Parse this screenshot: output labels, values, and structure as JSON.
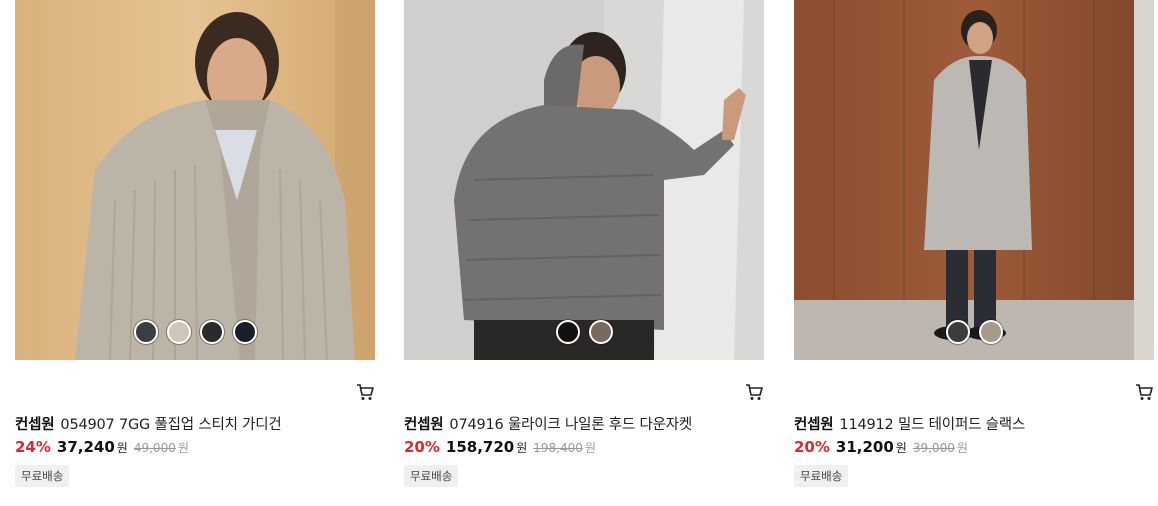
{
  "products": [
    {
      "brand": "컨셉원",
      "name": "054907 7GG 풀집업 스티치 가디건",
      "discount": "24%",
      "price": "37,240",
      "currency": "원",
      "original_price": "49,000",
      "badge": "무료배송",
      "swatch_colors": [
        "#3b3f44",
        "#cfc6b5",
        "#2b2b2b",
        "#1a1e2a"
      ]
    },
    {
      "brand": "컨셉원",
      "name": "074916 울라이크 나일론 후드 다운자켓",
      "discount": "20%",
      "price": "158,720",
      "currency": "원",
      "original_price": "198,400",
      "badge": "무료배송",
      "swatch_colors": [
        "#111111",
        "#7a6a5e"
      ]
    },
    {
      "brand": "컨셉원",
      "name": "114912 밀드 테이퍼드 슬랙스",
      "discount": "20%",
      "price": "31,200",
      "currency": "원",
      "original_price": "39,000",
      "badge": "무료배송",
      "swatch_colors": [
        "#3a3d3a",
        "#a89a86"
      ]
    }
  ],
  "icons": {
    "cart": "cart-icon"
  },
  "colors": {
    "discount": "#e0282c",
    "strikethrough": "#999999",
    "badge_bg": "#f0f0f0"
  }
}
